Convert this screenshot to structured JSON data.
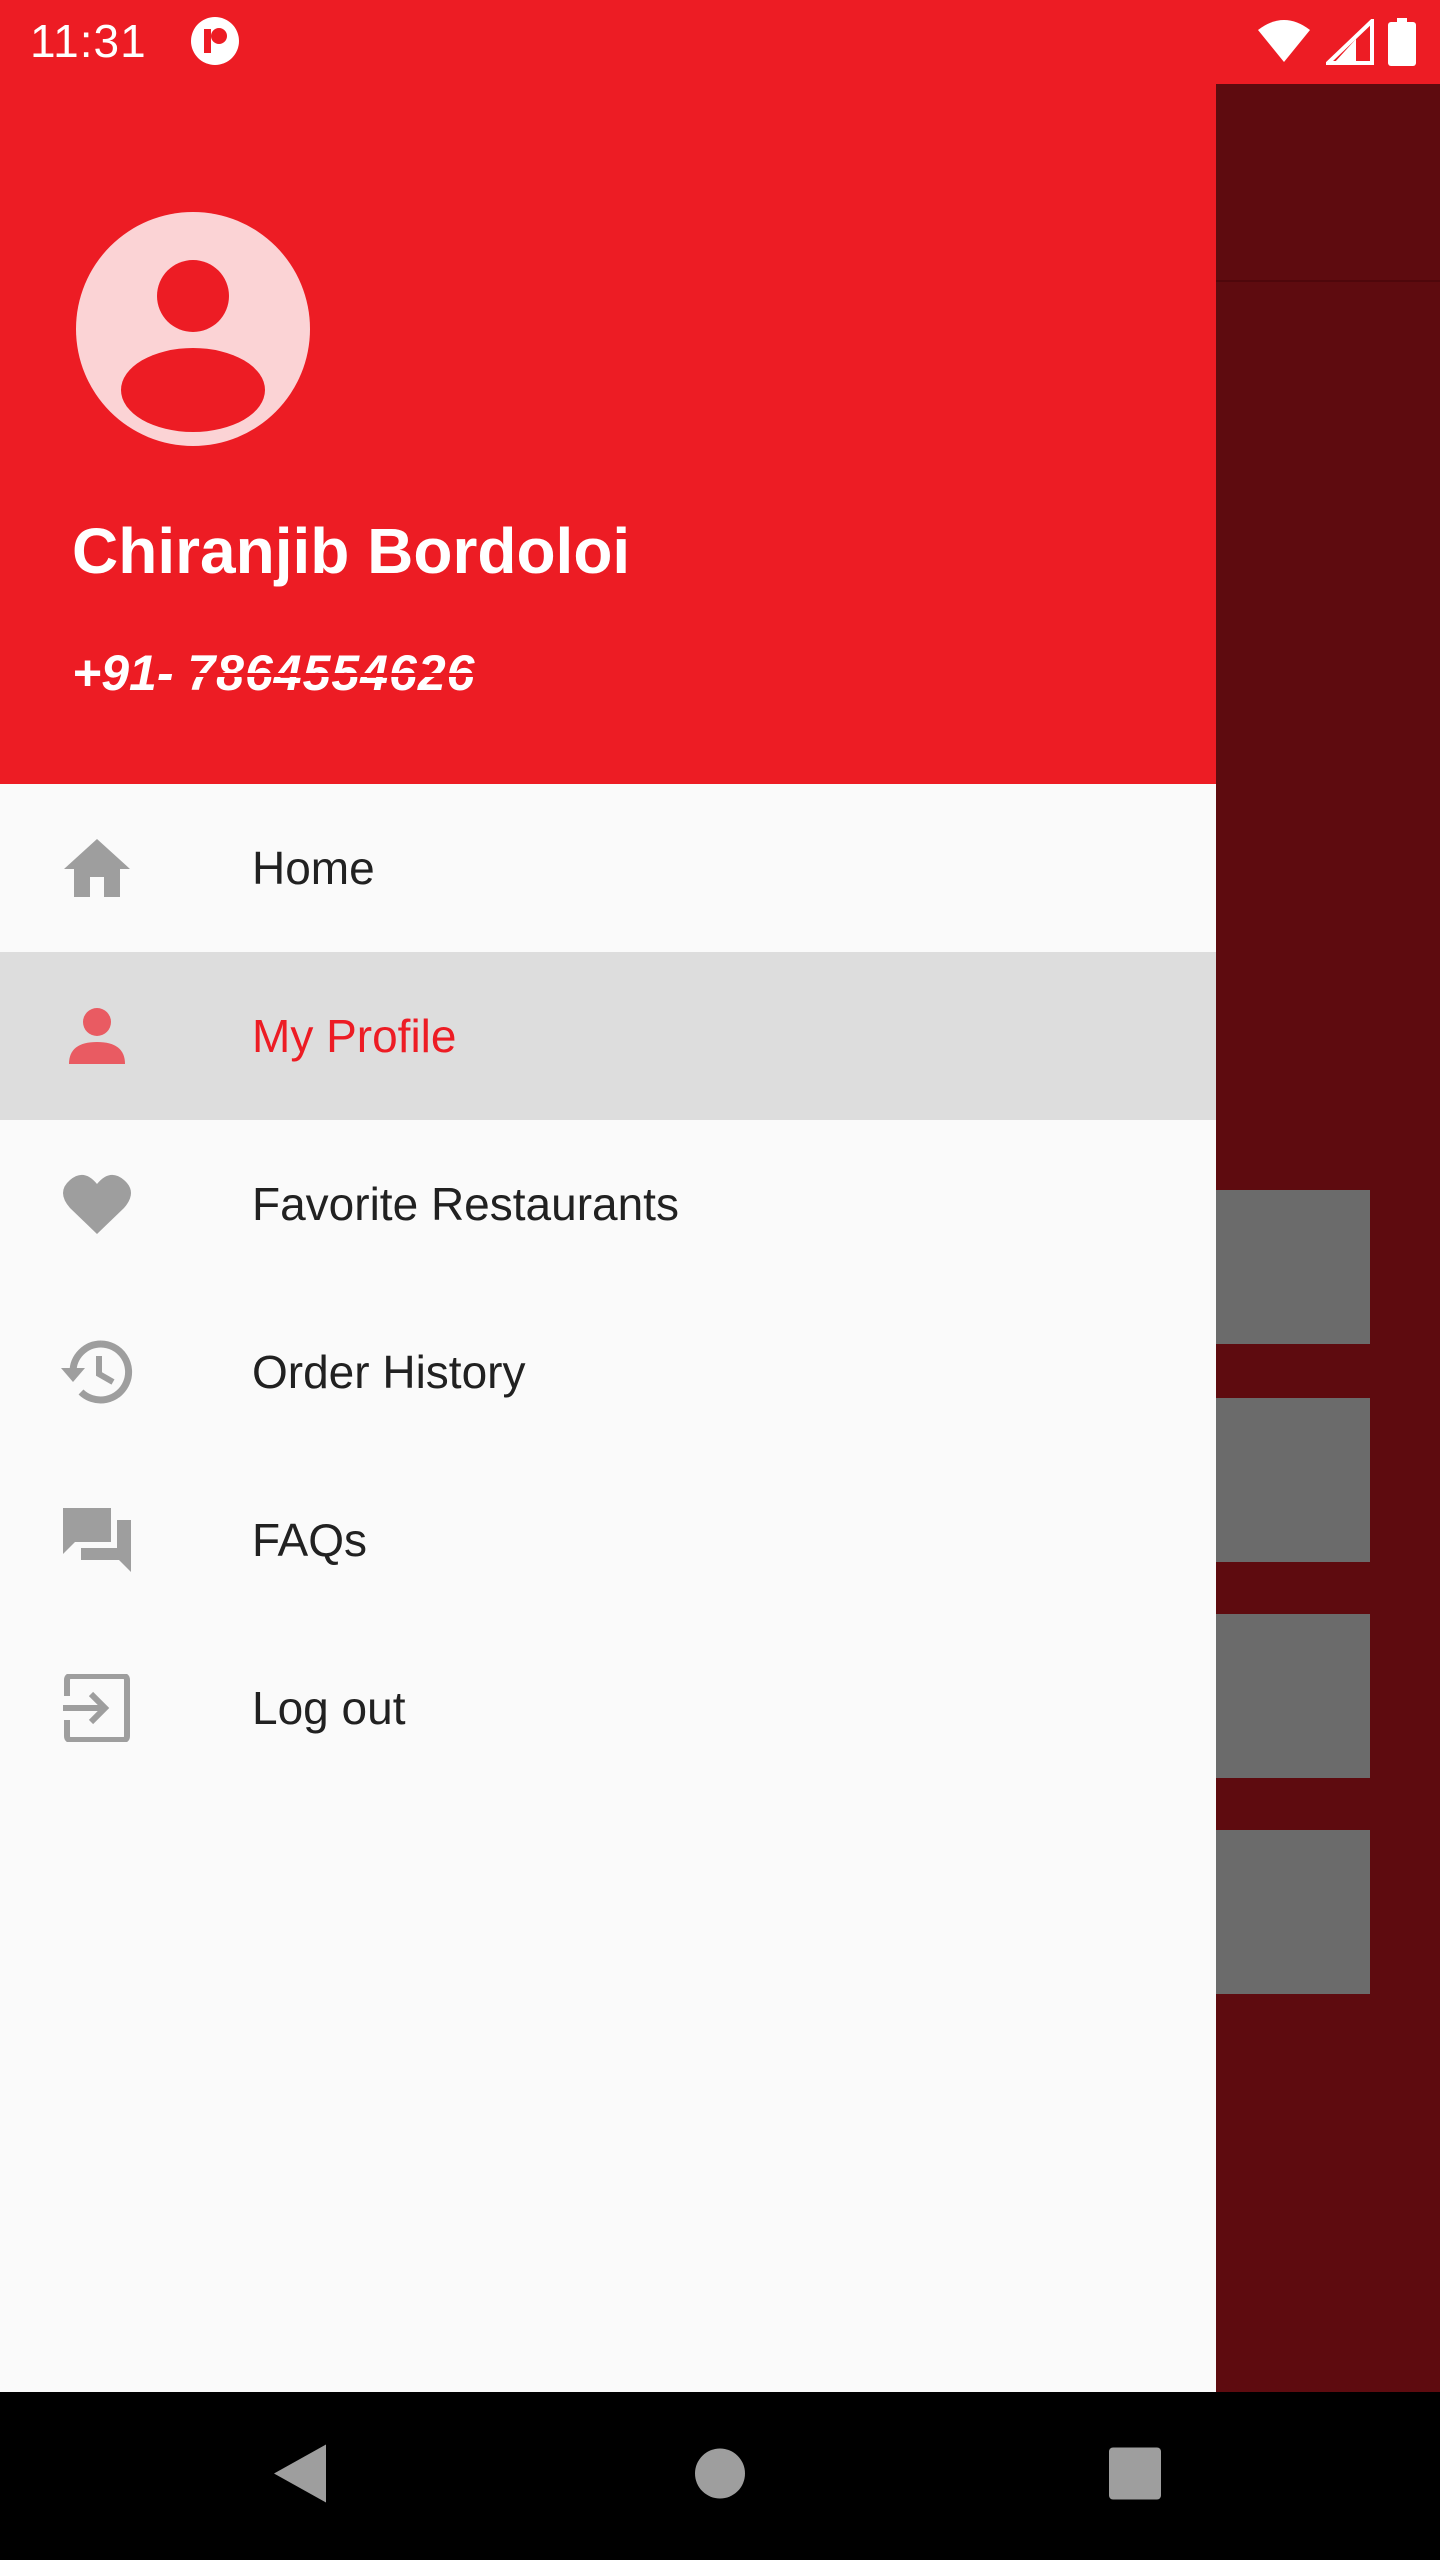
{
  "status_bar": {
    "time": "11:31",
    "icons": [
      "app-notification-icon",
      "wifi-icon",
      "signal-icon",
      "battery-icon"
    ]
  },
  "drawer": {
    "header": {
      "user_name": "Chiranjib Bordoloi",
      "phone_prefix": "+91- ",
      "phone_number": "7864554626"
    },
    "items": [
      {
        "label": "Home",
        "icon": "home-icon",
        "selected": false
      },
      {
        "label": "My Profile",
        "icon": "person-icon",
        "selected": true
      },
      {
        "label": "Favorite Restaurants",
        "icon": "heart-icon",
        "selected": false
      },
      {
        "label": "Order History",
        "icon": "history-icon",
        "selected": false
      },
      {
        "label": "FAQs",
        "icon": "forum-icon",
        "selected": false
      },
      {
        "label": "Log out",
        "icon": "logout-icon",
        "selected": false
      }
    ]
  },
  "colors": {
    "accent": "#ed1c24",
    "scrim": "#5e0b0f",
    "icon_gray": "#9e9e9e",
    "selected_bg": "#dddddd"
  },
  "nav_bar": {
    "buttons": [
      "back-button",
      "home-button",
      "recents-button"
    ]
  }
}
